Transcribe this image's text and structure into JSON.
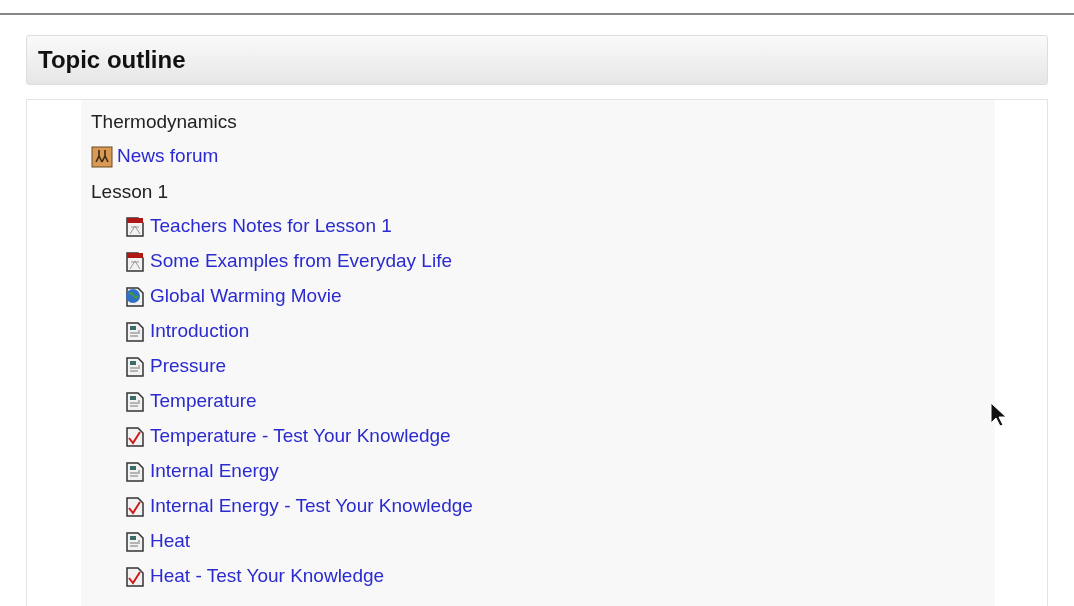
{
  "panel": {
    "title": "Topic outline"
  },
  "outline": [
    {
      "label": "Thermodynamics",
      "kind": "heading"
    },
    {
      "label": "News forum",
      "kind": "forum"
    },
    {
      "label": "Lesson 1",
      "kind": "heading",
      "children": [
        {
          "label": "Teachers Notes for Lesson 1",
          "kind": "pdf"
        },
        {
          "label": "Some Examples from Everyday Life",
          "kind": "pdf"
        },
        {
          "label": "Global Warming Movie",
          "kind": "web"
        },
        {
          "label": "Introduction",
          "kind": "page"
        },
        {
          "label": "Pressure",
          "kind": "page"
        },
        {
          "label": "Temperature",
          "kind": "page"
        },
        {
          "label": "Temperature - Test Your Knowledge",
          "kind": "quiz"
        },
        {
          "label": "Internal Energy",
          "kind": "page"
        },
        {
          "label": "Internal Energy - Test Your Knowledge",
          "kind": "quiz"
        },
        {
          "label": "Heat",
          "kind": "page"
        },
        {
          "label": "Heat - Test Your Knowledge",
          "kind": "quiz"
        }
      ]
    }
  ]
}
